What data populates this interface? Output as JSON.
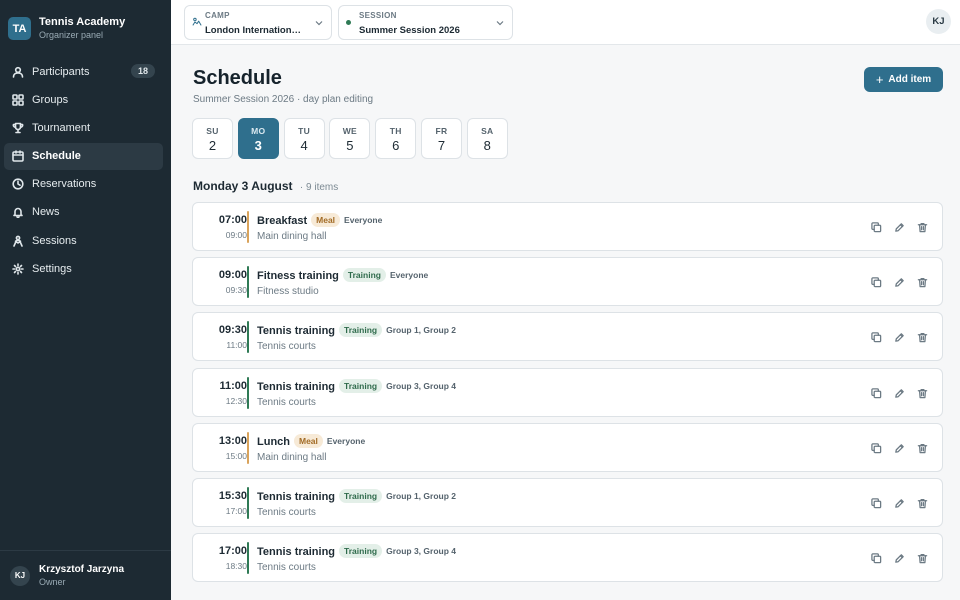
{
  "sidebar": {
    "brand": {
      "initials": "TA",
      "name": "Tennis Academy",
      "subtitle": "Organizer panel"
    },
    "items": [
      {
        "label": "Participants",
        "icon": "users-icon",
        "badge": "18",
        "active": false
      },
      {
        "label": "Groups",
        "icon": "grid-icon",
        "badge": "",
        "active": false
      },
      {
        "label": "Tournament",
        "icon": "trophy-icon",
        "badge": "",
        "active": false
      },
      {
        "label": "Schedule",
        "icon": "calendar-icon",
        "badge": "",
        "active": true
      },
      {
        "label": "Reservations",
        "icon": "clock-icon",
        "badge": "",
        "active": false
      },
      {
        "label": "News",
        "icon": "bell-icon",
        "badge": "",
        "active": false
      },
      {
        "label": "Sessions",
        "icon": "sessions-icon",
        "badge": "",
        "active": false
      },
      {
        "label": "Settings",
        "icon": "gear-icon",
        "badge": "",
        "active": false
      }
    ],
    "user": {
      "initials": "KJ",
      "name": "Krzysztof Jarzyna",
      "role": "Owner"
    }
  },
  "topbar": {
    "camp": {
      "label": "CAMP",
      "value": "London International..."
    },
    "session": {
      "label": "SESSION",
      "value": "Summer Session 2026"
    },
    "avatar": "KJ"
  },
  "main": {
    "title": "Schedule",
    "subtitle": "Summer Session 2026 · day plan editing",
    "add_label": "Add item",
    "days": [
      {
        "name": "SU",
        "num": "2",
        "active": false
      },
      {
        "name": "MO",
        "num": "3",
        "active": true
      },
      {
        "name": "TU",
        "num": "4",
        "active": false
      },
      {
        "name": "WE",
        "num": "5",
        "active": false
      },
      {
        "name": "TH",
        "num": "6",
        "active": false
      },
      {
        "name": "FR",
        "num": "7",
        "active": false
      },
      {
        "name": "SA",
        "num": "8",
        "active": false
      }
    ],
    "date_heading": "Monday 3 August",
    "item_count": "· 9 items",
    "items": [
      {
        "start": "07:00",
        "end": "09:00",
        "name": "Breakfast",
        "tag": "Meal",
        "type": "meal",
        "who": "Everyone",
        "place": "Main dining hall"
      },
      {
        "start": "09:00",
        "end": "09:30",
        "name": "Fitness training",
        "tag": "Training",
        "type": "training",
        "who": "Everyone",
        "place": "Fitness studio"
      },
      {
        "start": "09:30",
        "end": "11:00",
        "name": "Tennis training",
        "tag": "Training",
        "type": "training",
        "who": "Group 1, Group 2",
        "place": "Tennis courts"
      },
      {
        "start": "11:00",
        "end": "12:30",
        "name": "Tennis training",
        "tag": "Training",
        "type": "training",
        "who": "Group 3, Group 4",
        "place": "Tennis courts"
      },
      {
        "start": "13:00",
        "end": "15:00",
        "name": "Lunch",
        "tag": "Meal",
        "type": "meal",
        "who": "Everyone",
        "place": "Main dining hall"
      },
      {
        "start": "15:30",
        "end": "17:00",
        "name": "Tennis training",
        "tag": "Training",
        "type": "training",
        "who": "Group 1, Group 2",
        "place": "Tennis courts"
      },
      {
        "start": "17:00",
        "end": "18:30",
        "name": "Tennis training",
        "tag": "Training",
        "type": "training",
        "who": "Group 3, Group 4",
        "place": "Tennis courts"
      }
    ]
  },
  "colors": {
    "accent": "#2f6f8d",
    "sidebar": "#1d2a33",
    "meal": "#d9a35b",
    "training": "#2f7a55"
  }
}
